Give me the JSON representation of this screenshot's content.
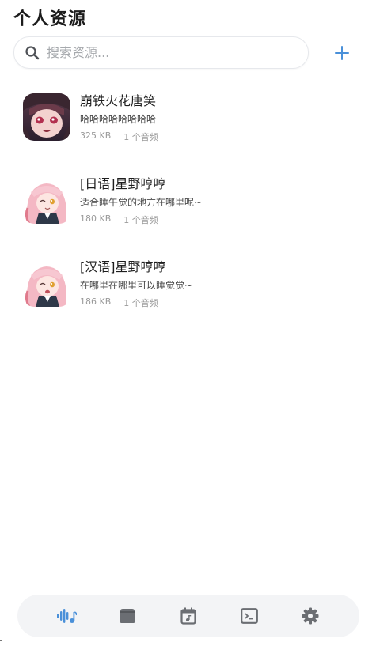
{
  "header": {
    "title": "个人资源"
  },
  "search": {
    "placeholder": "搜索资源..."
  },
  "resources": [
    {
      "name": "崩铁火花唐笑",
      "desc": "哈哈哈哈哈哈哈哈",
      "size": "325 KB",
      "count": "1 个音频"
    },
    {
      "name": "[日语]星野哼哼",
      "desc": "适合睡午觉的地方在哪里呢~",
      "size": "180 KB",
      "count": "1 个音频"
    },
    {
      "name": "[汉语]星野哼哼",
      "desc": "在哪里在哪里可以睡觉觉~",
      "size": "186 KB",
      "count": "1 个音频"
    }
  ],
  "nav": {
    "items": [
      {
        "icon": "audio-wave-icon",
        "active": true
      },
      {
        "icon": "shirt-icon",
        "active": false
      },
      {
        "icon": "calendar-music-icon",
        "active": false
      },
      {
        "icon": "terminal-icon",
        "active": false
      },
      {
        "icon": "gear-icon",
        "active": false
      }
    ]
  },
  "colors": {
    "accent": "#4a90d9",
    "nav_icon": "#6b6e73",
    "nav_bg": "#f3f4f6"
  }
}
